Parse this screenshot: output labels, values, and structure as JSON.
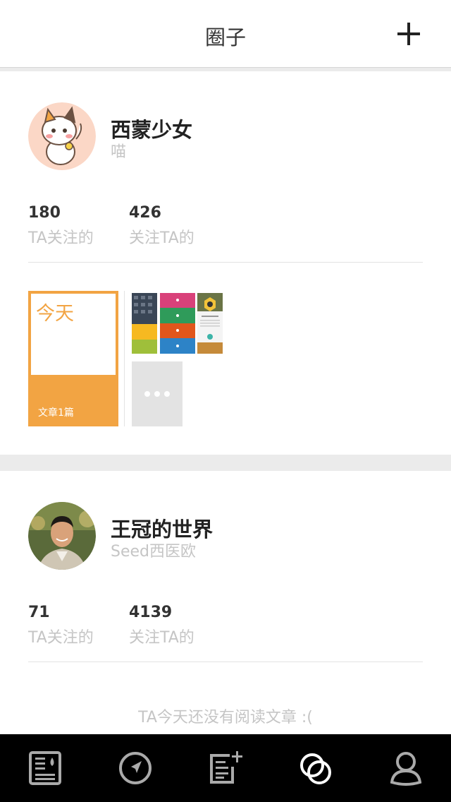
{
  "header": {
    "title": "圈子"
  },
  "users": [
    {
      "name": "西蒙少女",
      "subtitle": "喵",
      "following_count": "180",
      "following_label": "TA关注的",
      "followers_count": "426",
      "followers_label": "关注TA的",
      "today": {
        "label": "今天",
        "count_label": "文章1篇"
      }
    },
    {
      "name": "王冠的世界",
      "subtitle": "Seed西医欧",
      "following_count": "71",
      "following_label": "TA关注的",
      "followers_count": "4139",
      "followers_label": "关注TA的",
      "empty_note": "TA今天还没有阅读文章 :("
    }
  ],
  "tabs": [
    {
      "icon": "article-icon",
      "active": false
    },
    {
      "icon": "compass-icon",
      "active": false
    },
    {
      "icon": "write-icon",
      "active": false
    },
    {
      "icon": "circles-icon",
      "active": true
    },
    {
      "icon": "profile-icon",
      "active": false
    }
  ],
  "colors": {
    "accent": "#f2a443",
    "muted": "#c5c5c5",
    "tabbar": "#000000"
  }
}
